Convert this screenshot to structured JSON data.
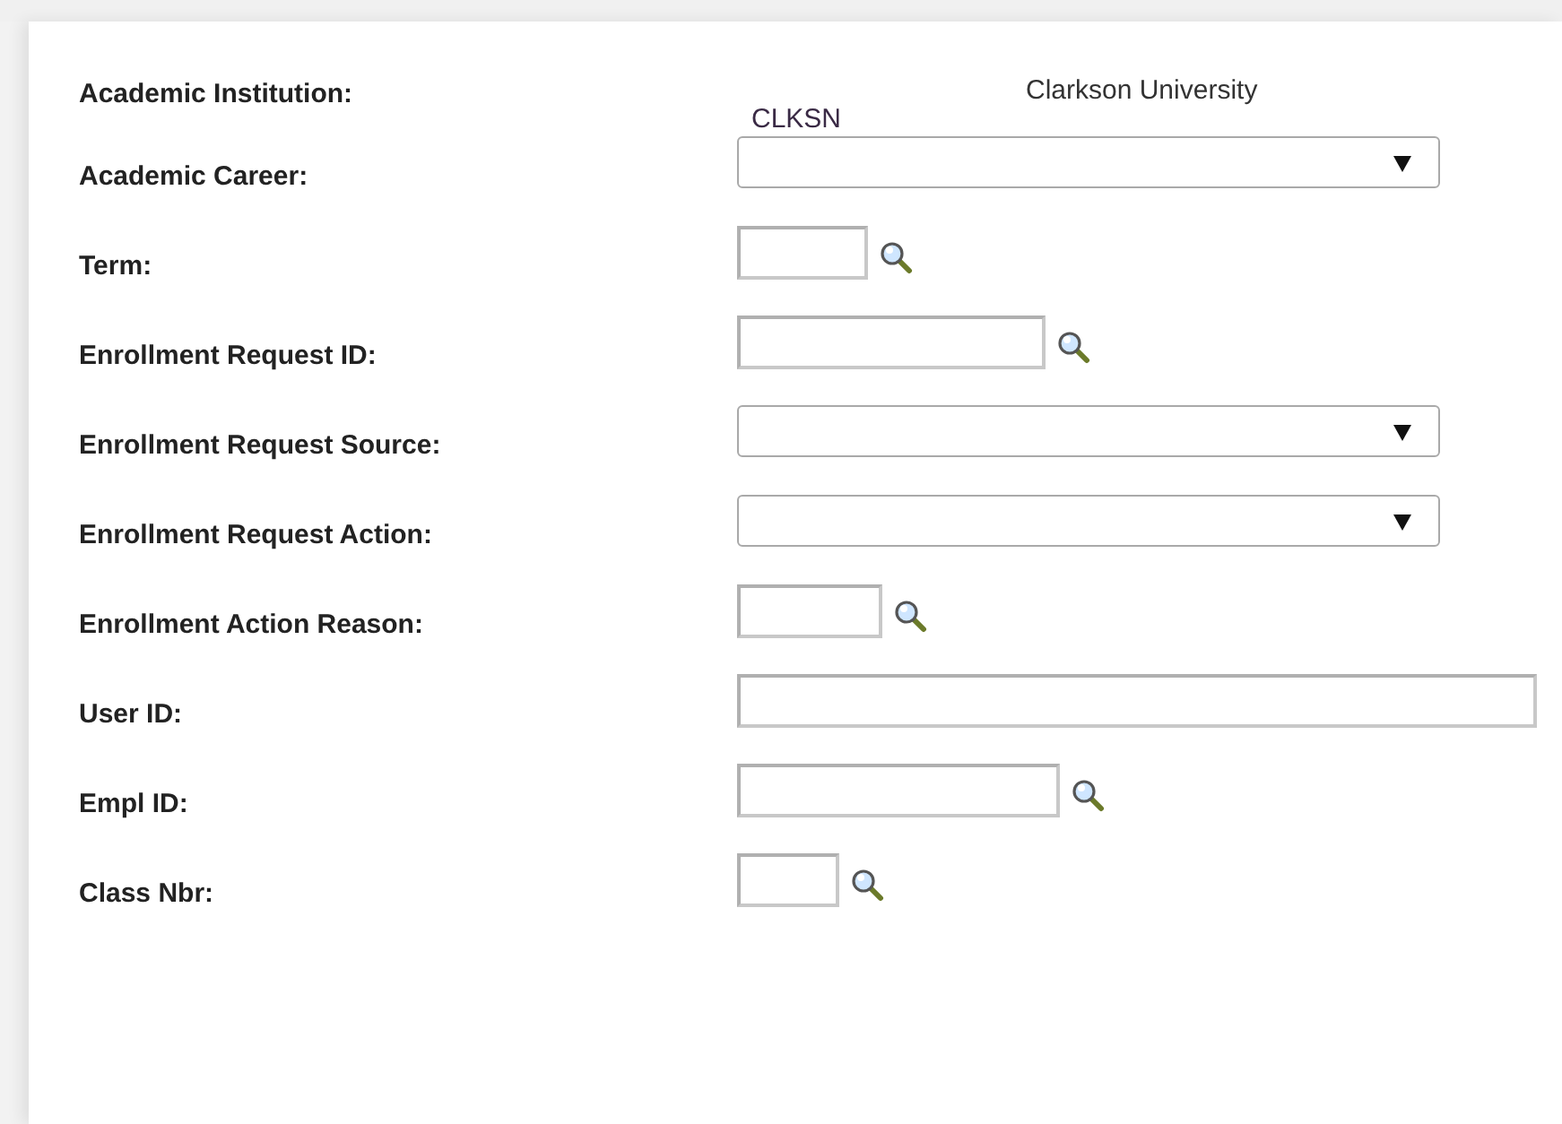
{
  "fields": [
    {
      "label": "Academic Institution:",
      "kind": "display",
      "value": "CLKSN",
      "description": "Clarkson University"
    },
    {
      "label": "Academic Career:",
      "kind": "select"
    },
    {
      "label": "Term:",
      "kind": "lookup"
    },
    {
      "label": "Enrollment Request ID:",
      "kind": "lookup"
    },
    {
      "label": "Enrollment Request Source:",
      "kind": "select"
    },
    {
      "label": "Enrollment Request Action:",
      "kind": "select"
    },
    {
      "label": "Enrollment Action Reason:",
      "kind": "lookup"
    },
    {
      "label": "User ID:",
      "kind": "text"
    },
    {
      "label": "Empl ID:",
      "kind": "lookup"
    },
    {
      "label": "Class Nbr:",
      "kind": "lookup"
    }
  ]
}
